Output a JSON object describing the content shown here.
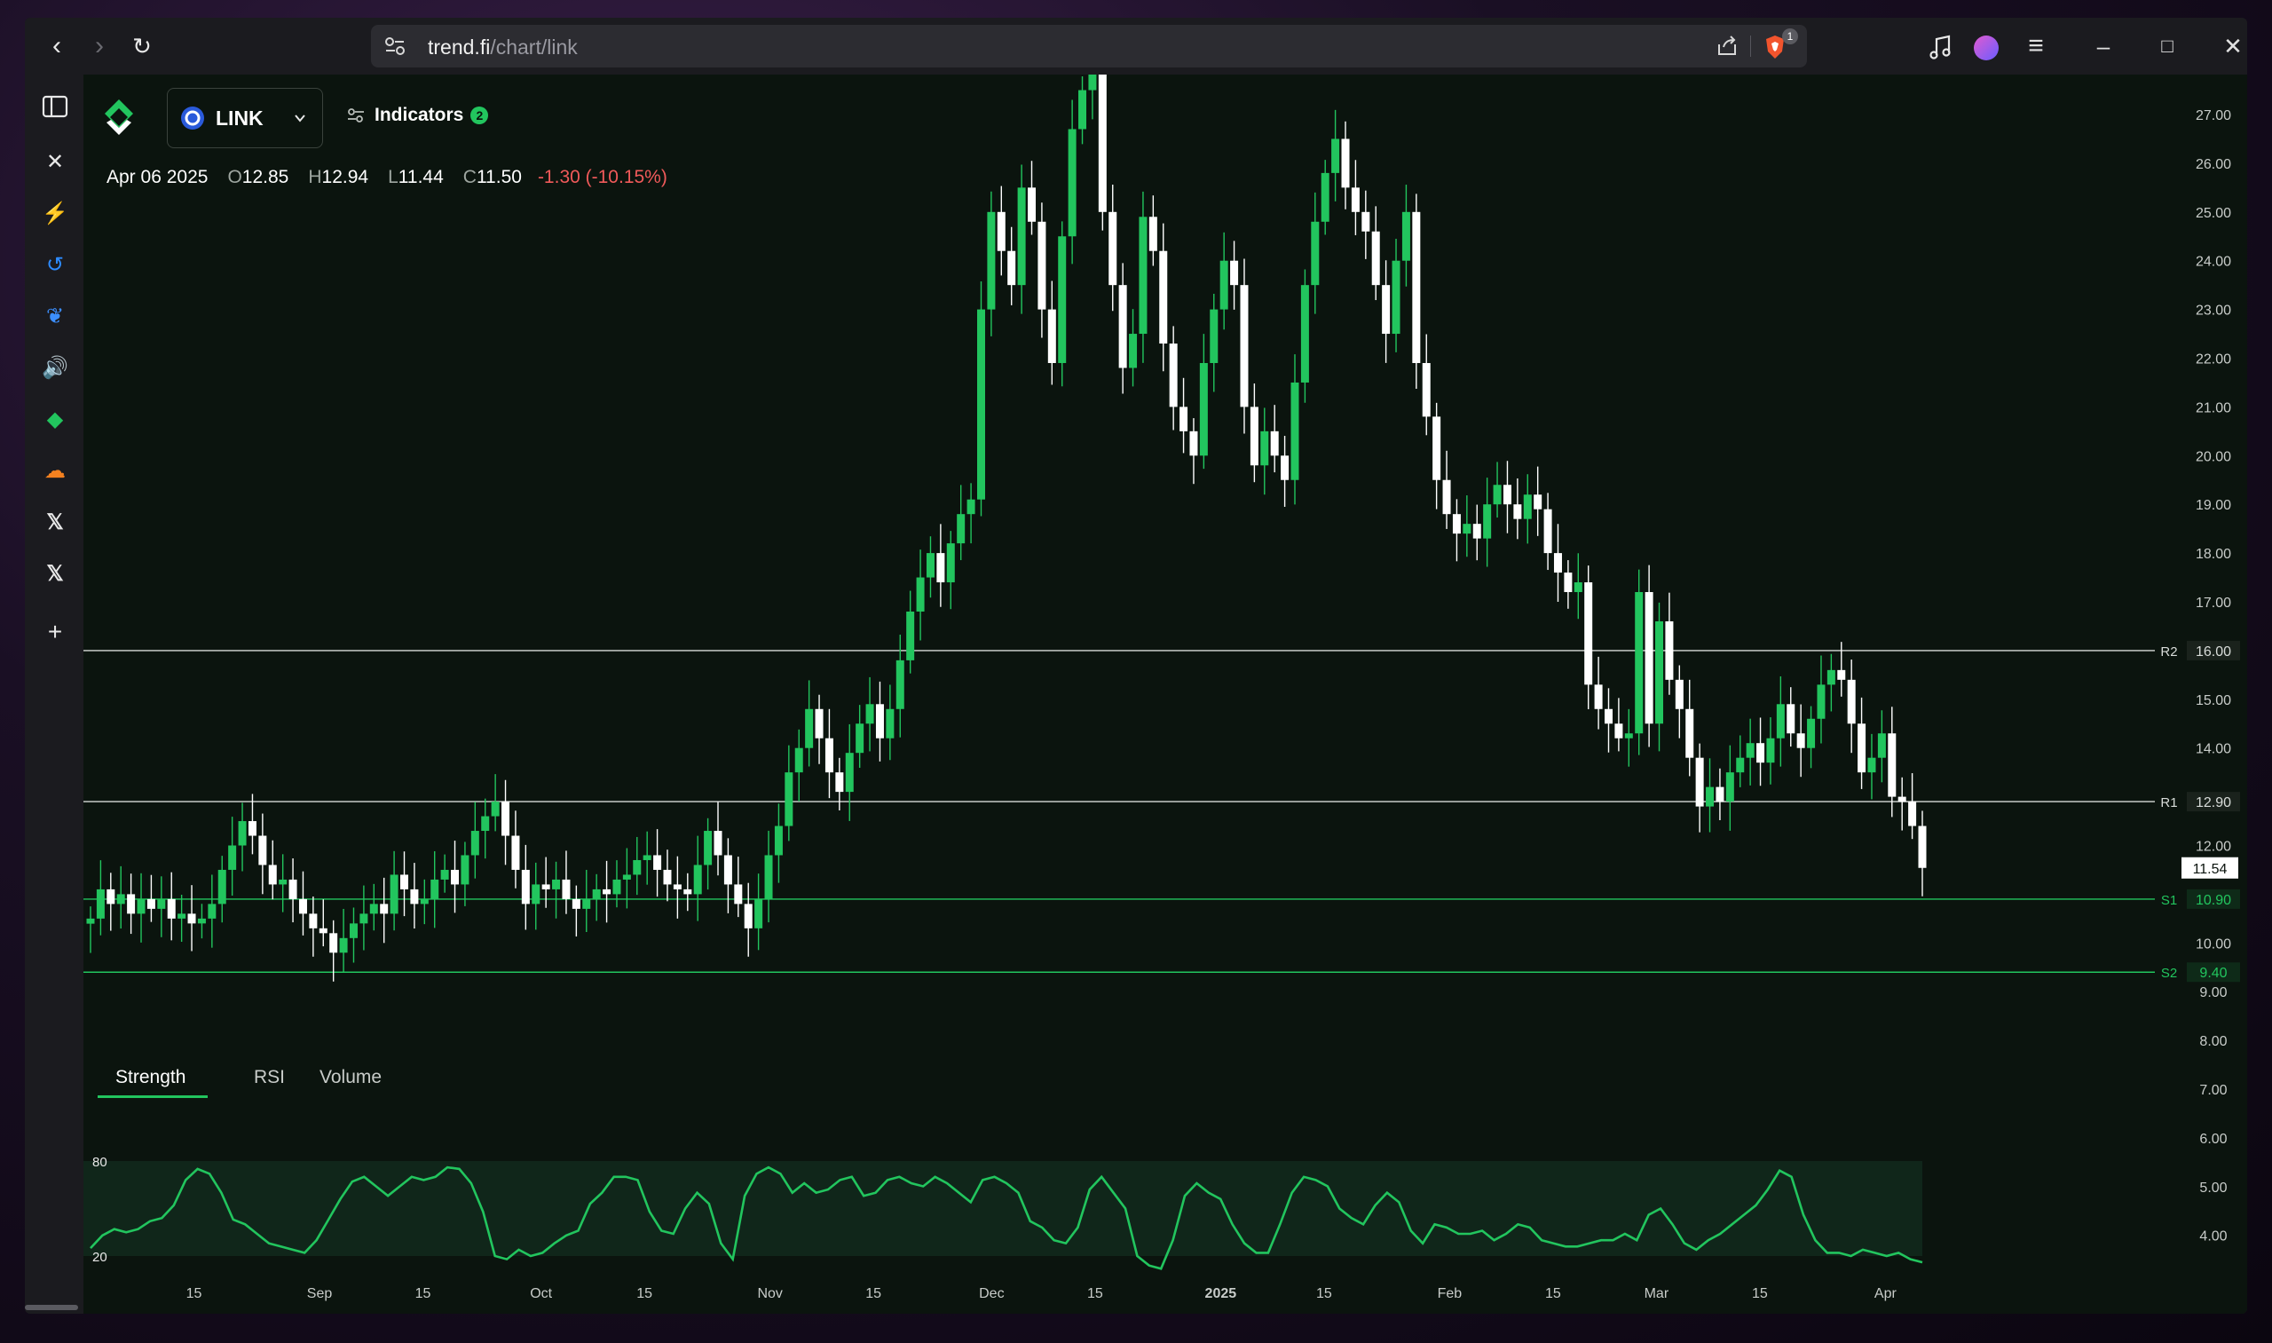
{
  "browser": {
    "url_host": "trend.fi",
    "url_path": "/chart/link",
    "shield_badge": "1"
  },
  "app": {
    "symbol": "LINK",
    "indicators_label": "Indicators",
    "indicators_count": "2",
    "ohlc": {
      "date": "Apr 06 2025",
      "o_label": "O",
      "o": "12.85",
      "h_label": "H",
      "h": "12.94",
      "l_label": "L",
      "l": "11.44",
      "c_label": "C",
      "c": "11.50",
      "change": "-1.30 (-10.15%)"
    },
    "tabs": [
      "Strength",
      "RSI",
      "Volume"
    ],
    "colors": {
      "up": "#22c55e",
      "down": "#ffffff",
      "background": "#0b140e",
      "accent": "#22c55e"
    }
  },
  "chart_data": {
    "type": "candlestick",
    "y_ticks": [
      "27.00",
      "26.00",
      "25.00",
      "24.00",
      "23.00",
      "22.00",
      "21.00",
      "20.00",
      "19.00",
      "18.00",
      "17.00",
      "16.00",
      "15.00",
      "14.00",
      "13.00",
      "12.00",
      "11.00",
      "10.00",
      "9.00",
      "8.00",
      "7.00",
      "6.00",
      "5.00",
      "4.00"
    ],
    "y_range": [
      3.6,
      27.6
    ],
    "x_ticks": [
      "15",
      "Sep",
      "15",
      "Oct",
      "15",
      "Nov",
      "15",
      "Dec",
      "15",
      "2025",
      "15",
      "Feb",
      "15",
      "Mar",
      "15",
      "Apr"
    ],
    "x_tick_dates": [
      "2024-08-15",
      "2024-09-01",
      "2024-09-15",
      "2024-10-01",
      "2024-10-15",
      "2024-11-01",
      "2024-11-15",
      "2024-12-01",
      "2024-12-15",
      "2025-01-01",
      "2025-01-15",
      "2025-02-01",
      "2025-02-15",
      "2025-03-01",
      "2025-03-15",
      "2025-04-01"
    ],
    "current_price": "11.54",
    "levels": [
      {
        "name": "R2",
        "value": 16.0,
        "label": "16.00"
      },
      {
        "name": "R1",
        "value": 12.9,
        "label": "12.90"
      },
      {
        "name": "S1",
        "value": 10.9,
        "label": "10.90"
      },
      {
        "name": "S2",
        "value": 9.4,
        "label": "9.40"
      }
    ],
    "close_series": [
      10.5,
      11.1,
      10.8,
      11.0,
      10.6,
      10.9,
      10.7,
      10.9,
      10.5,
      10.6,
      10.4,
      10.5,
      10.8,
      11.5,
      12.0,
      12.5,
      12.2,
      11.6,
      11.2,
      11.3,
      10.9,
      10.6,
      10.3,
      10.2,
      9.8,
      10.1,
      10.4,
      10.6,
      10.8,
      10.6,
      11.4,
      11.1,
      10.8,
      10.9,
      11.3,
      11.5,
      11.2,
      11.8,
      12.3,
      12.6,
      12.9,
      12.2,
      11.5,
      10.8,
      11.2,
      11.1,
      11.3,
      10.9,
      10.7,
      10.9,
      11.1,
      11.0,
      11.3,
      11.4,
      11.7,
      11.8,
      11.5,
      11.2,
      11.1,
      11.0,
      11.6,
      12.3,
      11.8,
      11.2,
      10.8,
      10.3,
      10.9,
      11.8,
      12.4,
      13.5,
      14.0,
      14.8,
      14.2,
      13.5,
      13.1,
      13.9,
      14.5,
      14.9,
      14.2,
      14.8,
      15.8,
      16.8,
      17.5,
      18.0,
      17.4,
      18.2,
      18.8,
      19.1,
      23.0,
      25.0,
      24.2,
      23.5,
      25.5,
      24.8,
      23.0,
      21.9,
      24.5,
      26.7,
      27.5,
      28.0,
      25.0,
      23.5,
      21.8,
      22.5,
      24.9,
      24.2,
      22.3,
      21.0,
      20.5,
      20.0,
      21.9,
      23.0,
      24.0,
      23.5,
      21.0,
      19.8,
      20.5,
      20.0,
      19.5,
      21.5,
      23.5,
      24.8,
      25.8,
      26.5,
      25.5,
      25.0,
      24.6,
      23.5,
      22.5,
      24.0,
      25.0,
      21.9,
      20.8,
      19.5,
      18.8,
      18.4,
      18.6,
      18.3,
      19.0,
      19.4,
      19.0,
      18.7,
      19.2,
      18.9,
      18.0,
      17.6,
      17.2,
      17.4,
      15.3,
      14.8,
      14.5,
      14.2,
      14.3,
      17.2,
      14.5,
      16.6,
      15.4,
      14.8,
      13.8,
      12.8,
      13.2,
      12.9,
      13.5,
      13.8,
      14.1,
      13.7,
      14.2,
      14.9,
      14.3,
      14.0,
      14.6,
      15.3,
      15.6,
      15.4,
      14.5,
      13.5,
      13.8,
      14.3,
      13.0,
      12.9,
      12.4,
      11.54
    ],
    "strength": {
      "y_labels": [
        "80",
        "20"
      ],
      "band": [
        20,
        80
      ],
      "y_range": [
        0,
        100
      ],
      "values": [
        25,
        33,
        37,
        35,
        37,
        42,
        44,
        52,
        68,
        75,
        72,
        60,
        43,
        40,
        34,
        28,
        26,
        24,
        22,
        30,
        43,
        56,
        67,
        70,
        64,
        58,
        64,
        70,
        68,
        70,
        76,
        75,
        66,
        48,
        20,
        18,
        24,
        20,
        22,
        28,
        33,
        36,
        53,
        60,
        70,
        70,
        68,
        48,
        36,
        34,
        50,
        60,
        53,
        28,
        18,
        58,
        72,
        76,
        72,
        60,
        66,
        60,
        62,
        68,
        70,
        58,
        60,
        68,
        70,
        66,
        64,
        70,
        66,
        60,
        54,
        68,
        70,
        66,
        60,
        42,
        38,
        30,
        28,
        38,
        62,
        70,
        60,
        50,
        20,
        14,
        12,
        30,
        58,
        66,
        60,
        56,
        40,
        28,
        22,
        22,
        40,
        60,
        70,
        68,
        64,
        50,
        44,
        40,
        52,
        60,
        54,
        36,
        28,
        40,
        38,
        34,
        34,
        36,
        30,
        34,
        40,
        38,
        30,
        28,
        26,
        26,
        28,
        30,
        30,
        34,
        30,
        46,
        50,
        40,
        28,
        24,
        30,
        34,
        40,
        46,
        52,
        62,
        74,
        70,
        46,
        30,
        22,
        22,
        20,
        24,
        22,
        20,
        22,
        18,
        16
      ]
    }
  }
}
